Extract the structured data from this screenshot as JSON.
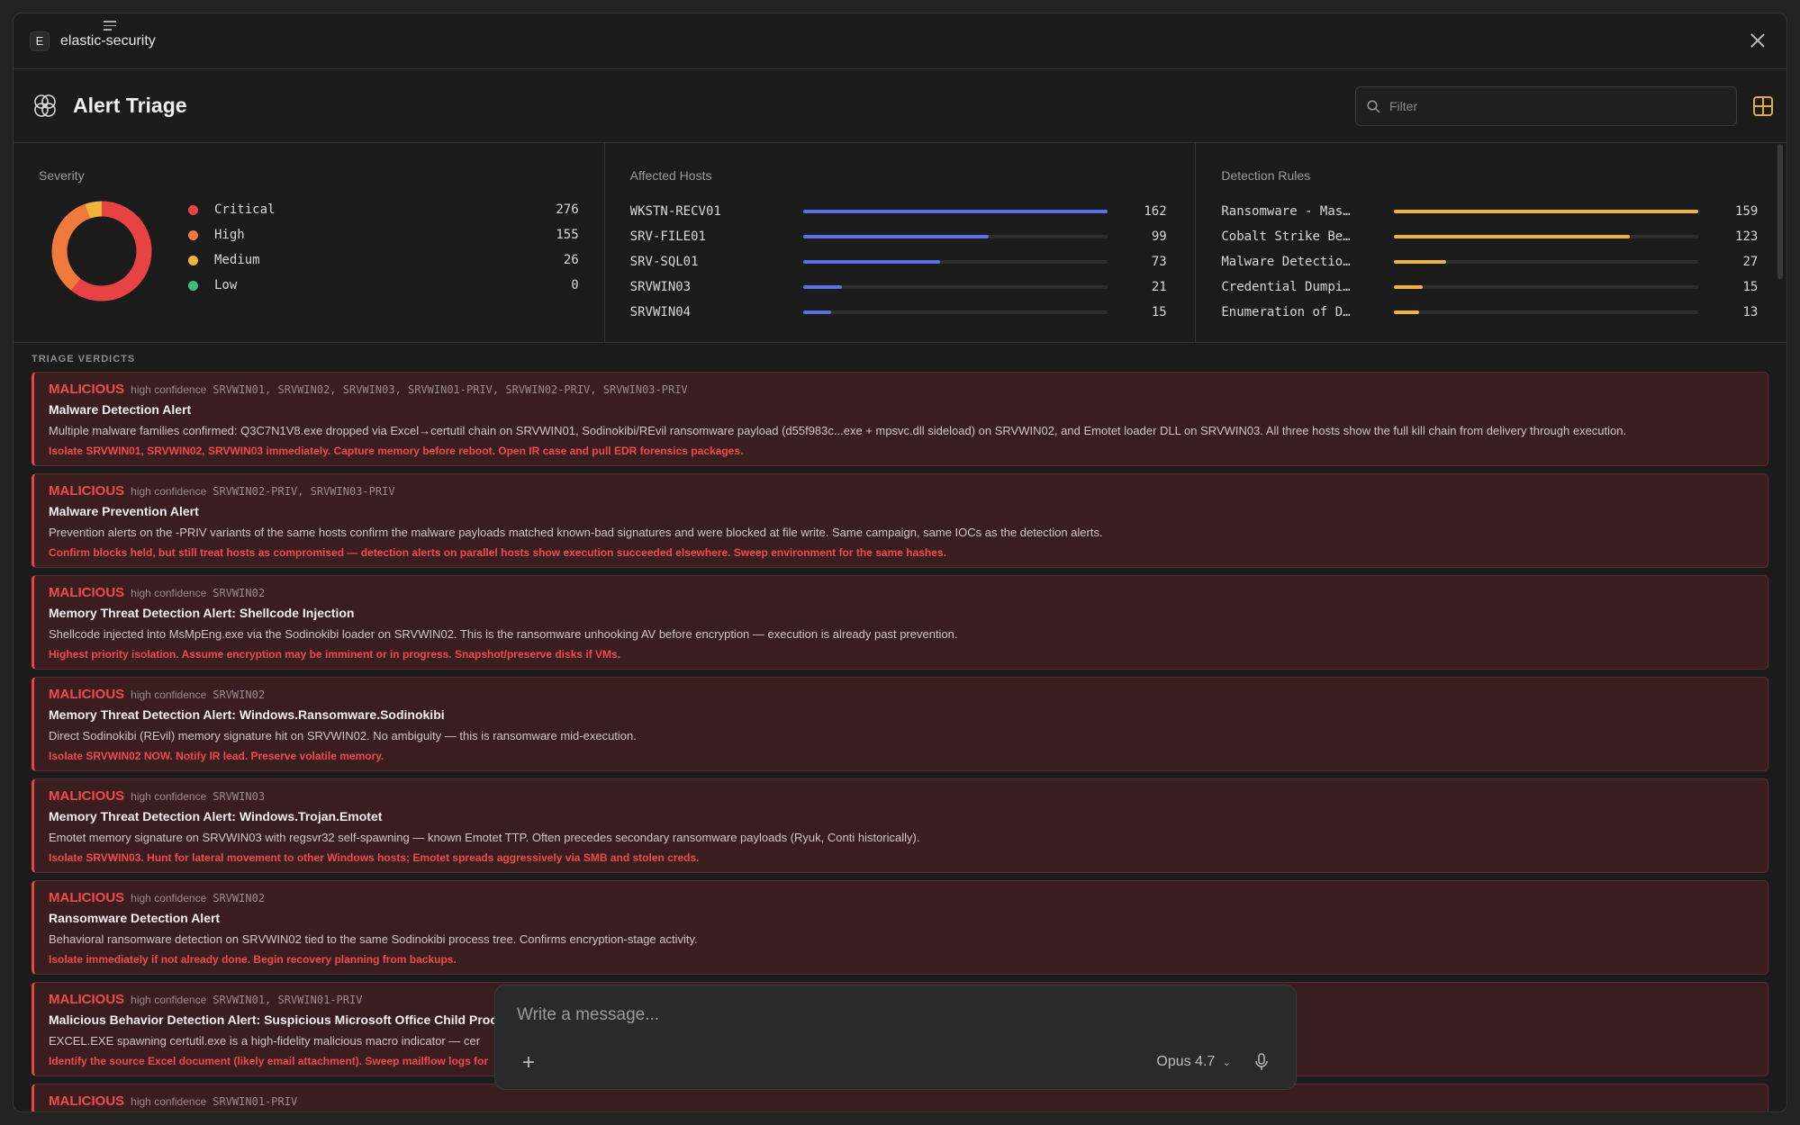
{
  "titlebar": {
    "badge": "E",
    "app_name": "elastic-security"
  },
  "header": {
    "title": "Alert Triage",
    "filter_placeholder": "Filter"
  },
  "severity": {
    "title": "Severity",
    "items": [
      {
        "label": "Critical",
        "count": "276",
        "color": "#e84343"
      },
      {
        "label": "High",
        "count": "155",
        "color": "#f07a3c"
      },
      {
        "label": "Medium",
        "count": "26",
        "color": "#f0b33c"
      },
      {
        "label": "Low",
        "count": "0",
        "color": "#3cbf7a"
      }
    ]
  },
  "hosts": {
    "title": "Affected Hosts",
    "color": "#5b6fe8",
    "items": [
      {
        "label": "WKSTN-RECV01",
        "count": "162",
        "value": 162
      },
      {
        "label": "SRV-FILE01",
        "count": "99",
        "value": 99
      },
      {
        "label": "SRV-SQL01",
        "count": "73",
        "value": 73
      },
      {
        "label": "SRVWIN03",
        "count": "21",
        "value": 21
      },
      {
        "label": "SRVWIN04",
        "count": "15",
        "value": 15
      }
    ]
  },
  "rules": {
    "title": "Detection Rules",
    "color": "#f0b33c",
    "items": [
      {
        "label": "Ransomware - Mas…",
        "count": "159",
        "value": 159
      },
      {
        "label": "Cobalt Strike Be…",
        "count": "123",
        "value": 123
      },
      {
        "label": "Malware Detectio…",
        "count": "27",
        "value": 27
      },
      {
        "label": "Credential Dumpi…",
        "count": "15",
        "value": 15
      },
      {
        "label": "Enumeration of D…",
        "count": "13",
        "value": 13
      }
    ]
  },
  "verdicts": {
    "label": "TRIAGE VERDICTS",
    "cards": [
      {
        "verdict": "MALICIOUS",
        "confidence": "high confidence",
        "hosts": "SRVWIN01, SRVWIN02, SRVWIN03, SRVWIN01-PRIV, SRVWIN02-PRIV, SRVWIN03-PRIV",
        "title": "Malware Detection Alert",
        "desc": "Multiple malware families confirmed: Q3C7N1V8.exe dropped via Excel→certutil chain on SRVWIN01, Sodinokibi/REvil ransomware payload (d55f983c...exe + mpsvc.dll sideload) on SRVWIN02, and Emotet loader DLL on SRVWIN03. All three hosts show the full kill chain from delivery through execution.",
        "action": "Isolate SRVWIN01, SRVWIN02, SRVWIN03 immediately. Capture memory before reboot. Open IR case and pull EDR forensics packages."
      },
      {
        "verdict": "MALICIOUS",
        "confidence": "high confidence",
        "hosts": "SRVWIN02-PRIV, SRVWIN03-PRIV",
        "title": "Malware Prevention Alert",
        "desc": "Prevention alerts on the -PRIV variants of the same hosts confirm the malware payloads matched known-bad signatures and were blocked at file write. Same campaign, same IOCs as the detection alerts.",
        "action": "Confirm blocks held, but still treat hosts as compromised — detection alerts on parallel hosts show execution succeeded elsewhere. Sweep environment for the same hashes."
      },
      {
        "verdict": "MALICIOUS",
        "confidence": "high confidence",
        "hosts": "SRVWIN02",
        "title": "Memory Threat Detection Alert: Shellcode Injection",
        "desc": "Shellcode injected into MsMpEng.exe via the Sodinokibi loader on SRVWIN02. This is the ransomware unhooking AV before encryption — execution is already past prevention.",
        "action": "Highest priority isolation. Assume encryption may be imminent or in progress. Snapshot/preserve disks if VMs."
      },
      {
        "verdict": "MALICIOUS",
        "confidence": "high confidence",
        "hosts": "SRVWIN02",
        "title": "Memory Threat Detection Alert: Windows.Ransomware.Sodinokibi",
        "desc": "Direct Sodinokibi (REvil) memory signature hit on SRVWIN02. No ambiguity — this is ransomware mid-execution.",
        "action": "Isolate SRVWIN02 NOW. Notify IR lead. Preserve volatile memory."
      },
      {
        "verdict": "MALICIOUS",
        "confidence": "high confidence",
        "hosts": "SRVWIN03",
        "title": "Memory Threat Detection Alert: Windows.Trojan.Emotet",
        "desc": "Emotet memory signature on SRVWIN03 with regsvr32 self-spawning — known Emotet TTP. Often precedes secondary ransomware payloads (Ryuk, Conti historically).",
        "action": "Isolate SRVWIN03. Hunt for lateral movement to other Windows hosts; Emotet spreads aggressively via SMB and stolen creds."
      },
      {
        "verdict": "MALICIOUS",
        "confidence": "high confidence",
        "hosts": "SRVWIN02",
        "title": "Ransomware Detection Alert",
        "desc": "Behavioral ransomware detection on SRVWIN02 tied to the same Sodinokibi process tree. Confirms encryption-stage activity.",
        "action": "Isolate immediately if not already done. Begin recovery planning from backups."
      },
      {
        "verdict": "MALICIOUS",
        "confidence": "high confidence",
        "hosts": "SRVWIN01, SRVWIN01-PRIV",
        "title": "Malicious Behavior Detection Alert: Suspicious Microsoft Office Child Proce",
        "desc": "EXCEL.EXE spawning certutil.exe is a high-fidelity malicious macro indicator — cer",
        "action": "Identify the source Excel document (likely email attachment). Sweep mailflow logs for"
      },
      {
        "verdict": "MALICIOUS",
        "confidence": "high confidence",
        "hosts": "SRVWIN01-PRIV",
        "title": "",
        "desc": "",
        "action": ""
      }
    ]
  },
  "composer": {
    "placeholder": "Write a message...",
    "model": "Opus 4.7"
  }
}
